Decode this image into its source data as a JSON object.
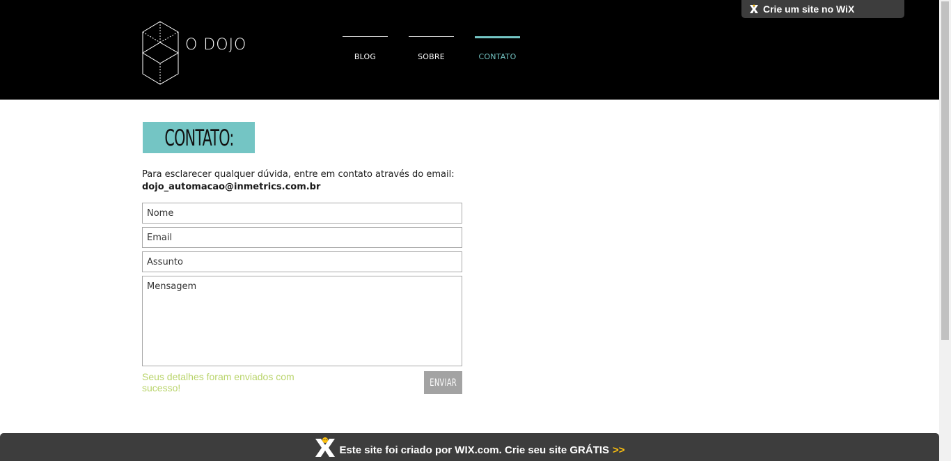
{
  "wix_banner_top": {
    "label": "Crie um site no WiX"
  },
  "logo": {
    "text": "O DOJO"
  },
  "nav": {
    "items": [
      {
        "label": "BLOG",
        "active": false
      },
      {
        "label": "SOBRE",
        "active": false
      },
      {
        "label": "CONTATO",
        "active": true
      }
    ]
  },
  "page": {
    "title": "CONTATO:",
    "intro": "Para esclarecer qualquer dúvida, entre em contato através do email:",
    "email": "dojo_automacao@inmetrics.com.br"
  },
  "form": {
    "name_placeholder": "Nome",
    "email_placeholder": "Email",
    "subject_placeholder": "Assunto",
    "message_placeholder": "Mensagem",
    "success_message": "Seus detalhes foram enviados com sucesso!",
    "submit_label": "ENVIAR"
  },
  "wix_footer": {
    "text": "Este site foi criado por WIX.com. Crie seu site GRÁTIS",
    "arrows": ">>"
  },
  "colors": {
    "accent": "#74c5c4",
    "header_bg": "#000000",
    "success": "#b9d46b",
    "wix_bar": "#3d3d3d",
    "wix_arrows": "#ffc20e"
  }
}
